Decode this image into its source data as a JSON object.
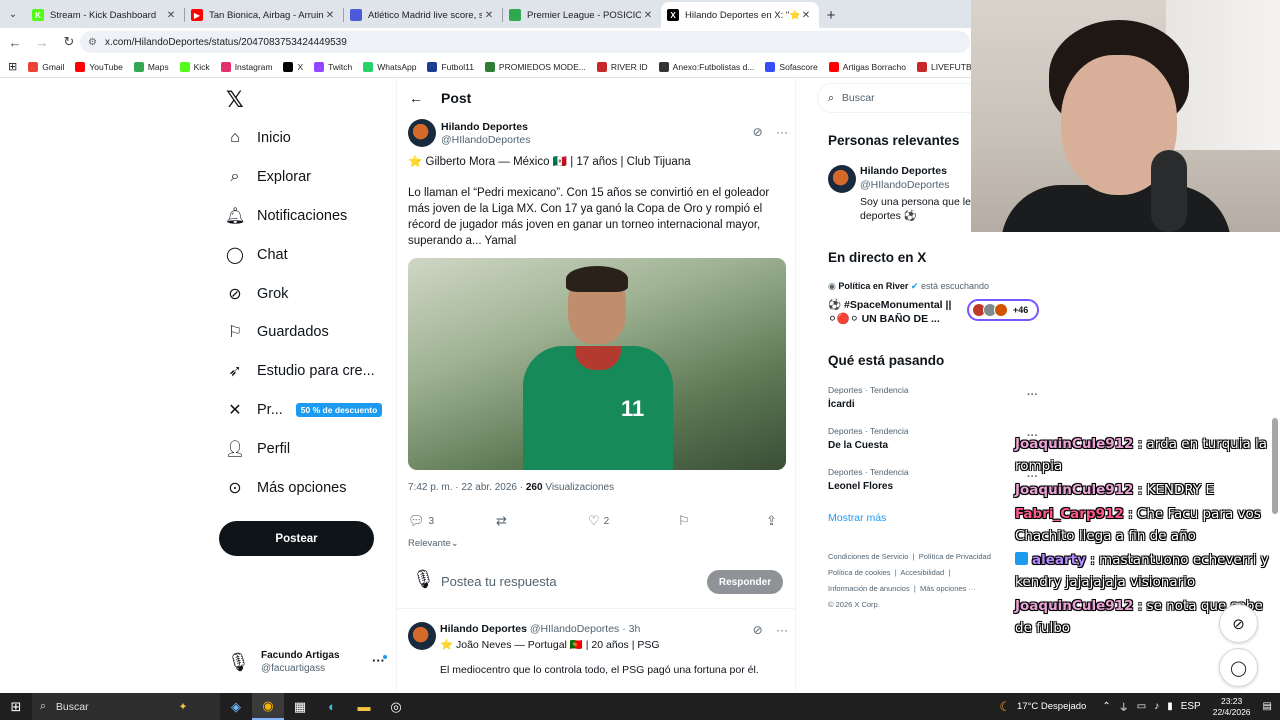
{
  "browser": {
    "tabs": [
      {
        "label": "Stream - Kick Dashboard",
        "color": "#53fc18",
        "glyph": "K",
        "active": false
      },
      {
        "label": "Tan Bionica, Airbag - Arruinarse",
        "color": "#ff0000",
        "glyph": "▶",
        "active": false
      },
      {
        "label": "Atlético Madrid live score, sche",
        "color": "#4a5ad8",
        "glyph": "",
        "active": false
      },
      {
        "label": "Premier League - POSICIONES",
        "color": "#2fa84f",
        "glyph": "",
        "active": false
      },
      {
        "label": "Hilando Deportes en X: \"⭐ Gil",
        "color": "#000000",
        "glyph": "X",
        "active": true
      }
    ],
    "url": "x.com/HilandoDeportes/status/2047083753424449539",
    "bookmarks": [
      {
        "label": "Gmail",
        "color": "#ea4335"
      },
      {
        "label": "YouTube",
        "color": "#ff0000"
      },
      {
        "label": "Maps",
        "color": "#34a853"
      },
      {
        "label": "Kick",
        "color": "#53fc18"
      },
      {
        "label": "Instagram",
        "color": "#e1306c"
      },
      {
        "label": "X",
        "color": "#000000"
      },
      {
        "label": "Twitch",
        "color": "#9146ff"
      },
      {
        "label": "WhatsApp",
        "color": "#25d366"
      },
      {
        "label": "Futbol11",
        "color": "#1a3d8f"
      },
      {
        "label": "PROMIEDOS MODE...",
        "color": "#2e7d32"
      },
      {
        "label": "RIVER ID",
        "color": "#c62828"
      },
      {
        "label": "Anexo:Futbolistas d...",
        "color": "#333333"
      },
      {
        "label": "Sofascore",
        "color": "#374df5"
      },
      {
        "label": "Artigas Borracho",
        "color": "#ff0000"
      },
      {
        "label": "LIVEFUTBOL",
        "color": "#c62828"
      }
    ]
  },
  "nav": {
    "items": [
      {
        "label": "Inicio",
        "icon": "home-icon"
      },
      {
        "label": "Explorar",
        "icon": "search-icon"
      },
      {
        "label": "Notificaciones",
        "icon": "bell-icon"
      },
      {
        "label": "Chat",
        "icon": "chat-icon"
      },
      {
        "label": "Grok",
        "icon": "grok-icon"
      },
      {
        "label": "Guardados",
        "icon": "bookmark-icon"
      },
      {
        "label": "Estudio para cre...",
        "icon": "rocket-icon"
      },
      {
        "label": "Pr...",
        "icon": "x-premium-icon"
      },
      {
        "label": "Perfil",
        "icon": "person-icon"
      },
      {
        "label": "Más opciones",
        "icon": "more-circle-icon"
      }
    ],
    "promo_badge": "50 % de descuento",
    "post_button": "Postear",
    "account": {
      "name": "Facundo Artigas",
      "handle": "@facuartigass"
    }
  },
  "main": {
    "title": "Post",
    "tweet": {
      "author_name": "Hilando Deportes",
      "author_handle": "@HIlandoDeportes",
      "line1": "⭐ Gilberto Mora — México 🇲🇽 | 17 años | Club Tijuana",
      "body": "Lo llaman el “Pedri mexicano”. Con 15 años se convirtió en el goleador más joven de la Liga MX. Con 17 ya ganó la Copa de Oro y rompió el récord de jugador más joven en ganar un torneo internacional mayor, superando a... Yamal",
      "jersey_number": "11",
      "meta_time": "7:42 p. m. · 22 abr. 2026 · ",
      "meta_views_count": "260",
      "meta_views_label": " Visualizaciones",
      "replies": "3",
      "likes": "2"
    },
    "sort_label": "Relevante",
    "reply_placeholder": "Postea tu respuesta",
    "reply_button": "Responder",
    "reply2": {
      "name": "Hilando Deportes",
      "meta": " @HIlandoDeportes · 3h",
      "line": "⭐ João Neves — Portugal 🇵🇹 | 20 años | PSG",
      "body": "El mediocentro que lo controla todo, el PSG pagó una fortuna por él."
    }
  },
  "sidebar": {
    "search_placeholder": "Buscar",
    "relevant_title": "Personas relevantes",
    "relevant": {
      "name": "Hilando Deportes",
      "handle": "@HIlandoDeportes",
      "bio": "Soy una persona que le g hilos sobre deportes ⚽"
    },
    "live_title": "En directo en X",
    "live_host": "Política en River",
    "live_status": "está escuchando",
    "live_space_title": "⚽ #SpaceMonumental || ⚪🔴⚪ UN BAÑO DE ...",
    "live_count": "+46",
    "trends_title": "Qué está pasando",
    "trends": [
      {
        "category": "Deportes · Tendencia",
        "name": "İcardi"
      },
      {
        "category": "Deportes · Tendencia",
        "name": "De la Cuesta"
      },
      {
        "category": "Deportes · Tendencia",
        "name": "Leonel Flores"
      }
    ],
    "show_more": "Mostrar más",
    "footer": [
      "Condiciones de Servicio",
      "Política de Privacidad",
      "Política de cookies",
      "Accesibilidad",
      "Información de anuncios",
      "Más opciones ···",
      "© 2026 X Corp."
    ]
  },
  "chat": [
    {
      "user": "JoaquinCule912",
      "user_color": "#e9a3d6",
      "text": ": arda en turquia la rompia",
      "badge": false
    },
    {
      "user": "JoaquinCule912",
      "user_color": "#e9a3d6",
      "text": ": KENDRY E",
      "badge": false
    },
    {
      "user": "Fabri_Carp912",
      "user_color": "#ff5a8c",
      "text": ": Che Facu para vos Chachito llega a fin de año",
      "badge": false
    },
    {
      "user": "alearty",
      "user_color": "#b58cff",
      "text": ": mastantuono echeverri y kendry jajajajaja visionario",
      "badge": true
    },
    {
      "user": "JoaquinCule912",
      "user_color": "#e9a3d6",
      "text": ": se nota que sabe de fulbo",
      "badge": false
    }
  ],
  "taskbar": {
    "search_label": "Buscar",
    "weather": "17°C  Despejado",
    "lang": "ESP",
    "time": "23:23",
    "date": "22/4/2026"
  }
}
